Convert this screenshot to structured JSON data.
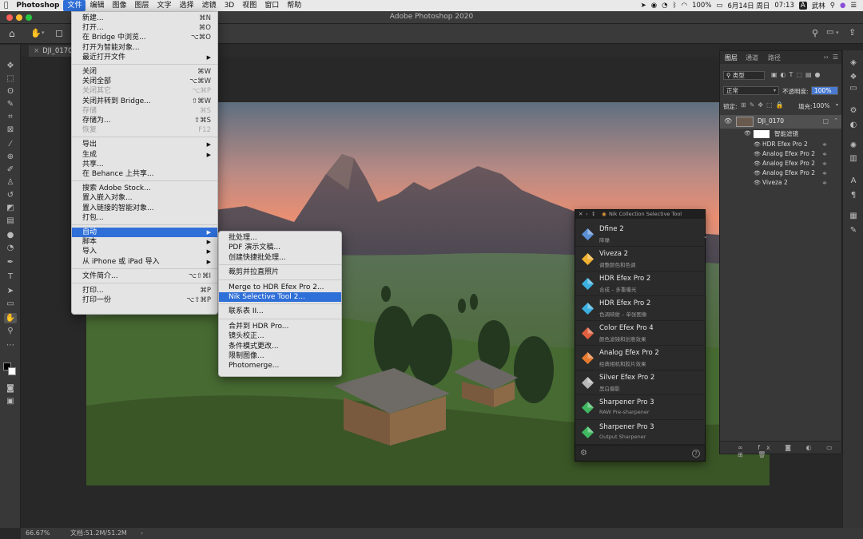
{
  "menubar": {
    "apple": "",
    "app": "Photoshop",
    "items": [
      "文件",
      "编辑",
      "图像",
      "图层",
      "文字",
      "选择",
      "滤镜",
      "3D",
      "视图",
      "窗口",
      "帮助"
    ],
    "battery": "100%",
    "date": "6月14日 周日",
    "time": "07:13",
    "input_method": "A",
    "user": "武林"
  },
  "window": {
    "title": "Adobe Photoshop 2020"
  },
  "document": {
    "tab": "DJI_0170-1"
  },
  "file_menu": [
    {
      "label": "新建...",
      "shortcut": "⌘N"
    },
    {
      "label": "打开...",
      "shortcut": "⌘O"
    },
    {
      "label": "在 Bridge 中浏览...",
      "shortcut": "⌥⌘O"
    },
    {
      "label": "打开为智能对象..."
    },
    {
      "label": "最近打开文件",
      "submenu": true
    },
    {
      "sep": true
    },
    {
      "label": "关闭",
      "shortcut": "⌘W"
    },
    {
      "label": "关闭全部",
      "shortcut": "⌥⌘W"
    },
    {
      "label": "关闭其它",
      "shortcut": "⌥⌘P",
      "disabled": true
    },
    {
      "label": "关闭并转到 Bridge...",
      "shortcut": "⇧⌘W"
    },
    {
      "label": "存储",
      "shortcut": "⌘S",
      "disabled": true
    },
    {
      "label": "存储为...",
      "shortcut": "⇧⌘S"
    },
    {
      "label": "恢复",
      "shortcut": "F12",
      "disabled": true
    },
    {
      "sep": true
    },
    {
      "label": "导出",
      "submenu": true
    },
    {
      "label": "生成",
      "submenu": true
    },
    {
      "label": "共享..."
    },
    {
      "label": "在 Behance 上共享..."
    },
    {
      "sep": true
    },
    {
      "label": "搜索 Adobe Stock..."
    },
    {
      "label": "置入嵌入对象..."
    },
    {
      "label": "置入链接的智能对象..."
    },
    {
      "label": "打包..."
    },
    {
      "sep": true
    },
    {
      "label": "自动",
      "submenu": true,
      "selected": true
    },
    {
      "label": "脚本",
      "submenu": true
    },
    {
      "label": "导入",
      "submenu": true
    },
    {
      "label": "从 iPhone 或 iPad 导入",
      "submenu": true
    },
    {
      "sep": true
    },
    {
      "label": "文件简介...",
      "shortcut": "⌥⇧⌘I"
    },
    {
      "sep": true
    },
    {
      "label": "打印...",
      "shortcut": "⌘P"
    },
    {
      "label": "打印一份",
      "shortcut": "⌥⇧⌘P"
    }
  ],
  "auto_submenu": [
    {
      "label": "批处理..."
    },
    {
      "label": "PDF 演示文稿..."
    },
    {
      "label": "创建快捷批处理..."
    },
    {
      "sep": true
    },
    {
      "label": "裁剪并拉直照片"
    },
    {
      "sep": true
    },
    {
      "label": "Merge to HDR Efex Pro 2..."
    },
    {
      "label": "Nik Selective Tool 2...",
      "selected": true
    },
    {
      "sep": true
    },
    {
      "label": "联系表 II..."
    },
    {
      "sep": true
    },
    {
      "label": "合并到 HDR Pro..."
    },
    {
      "label": "镜头校正..."
    },
    {
      "label": "条件模式更改..."
    },
    {
      "label": "限制图像..."
    },
    {
      "label": "Photomerge..."
    }
  ],
  "nik": {
    "title": "Nik Collection Selective Tool",
    "items": [
      {
        "name": "Dfine 2",
        "sub": "降噪",
        "color": "#5b8fd6"
      },
      {
        "name": "Viveza 2",
        "sub": "调整颜色和色调",
        "color": "#f0b030"
      },
      {
        "name": "HDR Efex Pro 2",
        "sub": "合成 – 多重曝光",
        "color": "#3cb0e0"
      },
      {
        "name": "HDR Efex Pro 2",
        "sub": "色调映射 – 单张图像",
        "color": "#3cb0e0"
      },
      {
        "name": "Color Efex Pro 4",
        "sub": "颜色滤镜和创意效果",
        "color": "#e06040"
      },
      {
        "name": "Analog Efex Pro 2",
        "sub": "经典相机和胶片效果",
        "color": "#e87a30"
      },
      {
        "name": "Silver Efex Pro 2",
        "sub": "黑白摄影",
        "color": "#b8b8b8"
      },
      {
        "name": "Sharpener Pro 3",
        "sub": "RAW Pre-sharpener",
        "color": "#40b860"
      },
      {
        "name": "Sharpener Pro 3",
        "sub": "Output Sharpener",
        "color": "#40b860"
      }
    ]
  },
  "layers_panel": {
    "tabs": [
      "图层",
      "通道",
      "路径"
    ],
    "filter": "类型",
    "blend_mode": "正常",
    "opacity_label": "不透明度:",
    "opacity": "100%",
    "lock_label": "锁定:",
    "fill_label": "填充:",
    "fill": "100%",
    "layer_name": "DJI_0170",
    "smart_filter_label": "智能滤镜",
    "filters": [
      "HDR Efex Pro 2",
      "Analog Efex Pro 2",
      "Analog Efex Pro 2",
      "Analog Efex Pro 2",
      "Viveza 2"
    ]
  },
  "status": {
    "zoom": "66.67%",
    "doc": "文档:51.2M/51.2M"
  }
}
